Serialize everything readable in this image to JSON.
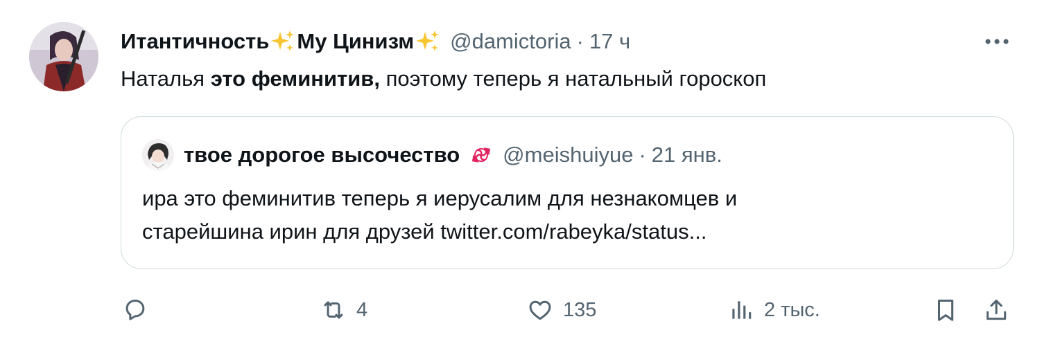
{
  "tweet": {
    "author": {
      "name_part1": "Итантичность",
      "name_part2": "My Цинизм",
      "handle": "@damictoria",
      "separator": "·",
      "time": "17 ч",
      "avatar_icon": "avatar-image"
    },
    "text": {
      "part1": "Наталья ",
      "bold": "это феминитив,",
      "part2": " поэтому теперь я натальный гороскоп"
    },
    "more_icon": "more-horizontal-icon"
  },
  "quote": {
    "author": {
      "name": "твое дорогое высочество",
      "handle": "@meishuiyue",
      "separator": "·",
      "time": "21 янв.",
      "emoji_icon": "candy-icon"
    },
    "text_line1": "ира это феминитив теперь я иерусалим для незнакомцев и",
    "text_line2": "старейшина ирин для друзей twitter.com/rabeyka/status..."
  },
  "actions": {
    "reply": {
      "icon": "reply-icon",
      "count": ""
    },
    "retweet": {
      "icon": "retweet-icon",
      "count": "4"
    },
    "like": {
      "icon": "heart-icon",
      "count": "135"
    },
    "views": {
      "icon": "views-icon",
      "count": "2 тыс."
    },
    "bookmark": {
      "icon": "bookmark-icon"
    },
    "share": {
      "icon": "share-icon"
    }
  },
  "colors": {
    "text": "#0f1419",
    "secondary": "#536471",
    "border": "#cfd9de",
    "sparkle": "#f7c531",
    "candy": "#e0245e"
  }
}
